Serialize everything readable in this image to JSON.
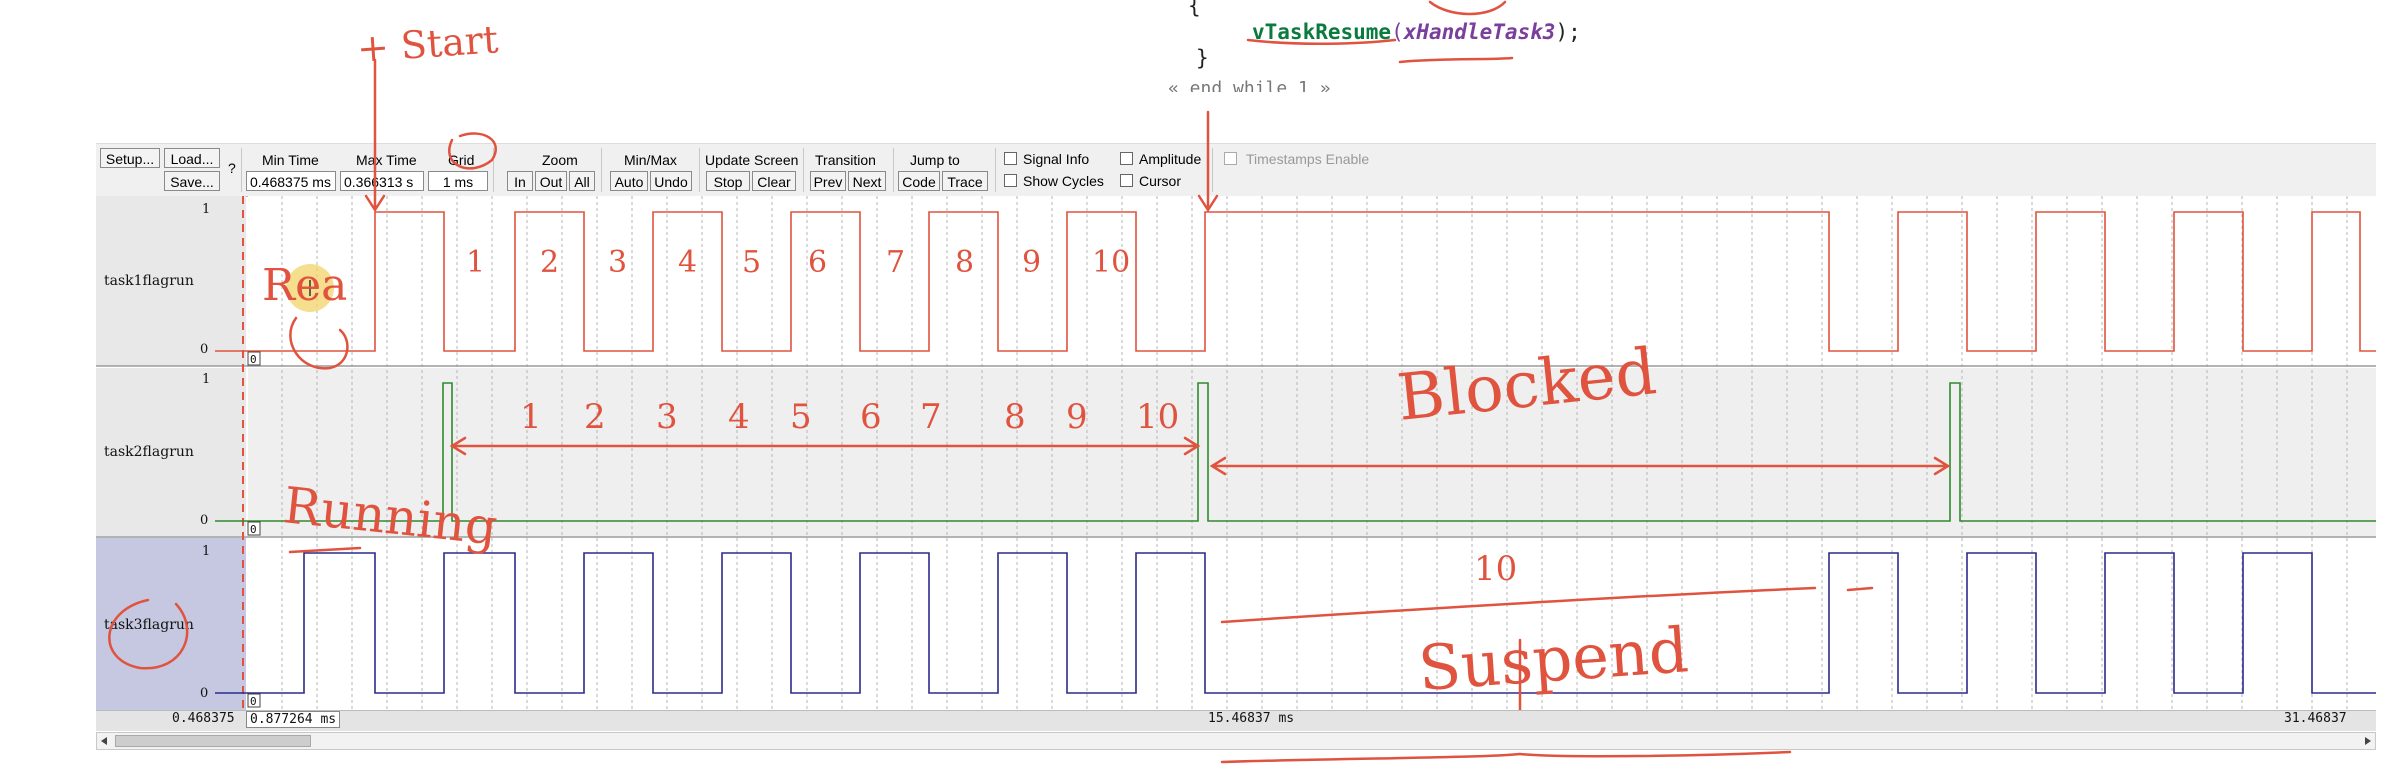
{
  "code": {
    "open_brace": "{",
    "call_fn": "vTaskResume",
    "call_open": "(",
    "call_arg": "xHandleTask3",
    "call_close": ");",
    "close_brace": "}",
    "comment": "« end while 1 »"
  },
  "toolbar": {
    "setup": "Setup...",
    "load": "Load...",
    "save": "Save...",
    "help": "?",
    "min_time_label": "Min Time",
    "min_time_value": "0.468375 ms",
    "max_time_label": "Max Time",
    "max_time_value": "0.366313 s",
    "grid_label": "Grid",
    "grid_value": "1 ms",
    "zoom_label": "Zoom",
    "zoom_in": "In",
    "zoom_out": "Out",
    "zoom_all": "All",
    "minmax_label": "Min/Max",
    "minmax_auto": "Auto",
    "minmax_undo": "Undo",
    "update_label": "Update Screen",
    "update_stop": "Stop",
    "update_clear": "Clear",
    "transition_label": "Transition",
    "transition_prev": "Prev",
    "transition_next": "Next",
    "jump_label": "Jump to",
    "jump_code": "Code",
    "jump_trace": "Trace",
    "signal_info": "Signal Info",
    "show_cycles": "Show Cycles",
    "amplitude": "Amplitude",
    "cursor": "Cursor",
    "timestamps": "Timestamps Enable"
  },
  "lanes": [
    {
      "name": "task1flagrun",
      "max": "1",
      "min": "0",
      "marker": "0",
      "color": "#e0533f"
    },
    {
      "name": "task2flagrun",
      "max": "1",
      "min": "0",
      "marker": "0",
      "color": "#2e8b2e"
    },
    {
      "name": "task3flagrun",
      "max": "1",
      "min": "0",
      "marker": "0",
      "color": "#2b2b8c"
    }
  ],
  "timeline": {
    "left": "0.468375",
    "cursor": "0.877264 ms",
    "mid": "15.46837 ms",
    "right": "31.46837"
  },
  "annotations": {
    "start": "+ Start",
    "ready": "Rea",
    "running": "Running",
    "blocked": "Blocked",
    "suspend": "Suspend",
    "ten": "10",
    "count_task1": [
      "1",
      "2",
      "3",
      "4",
      "5",
      "6",
      "7",
      "8",
      "9",
      "10"
    ],
    "count_task2": [
      "1",
      "2",
      "3",
      "4",
      "5",
      "6",
      "7",
      "8",
      "9",
      "10"
    ]
  }
}
